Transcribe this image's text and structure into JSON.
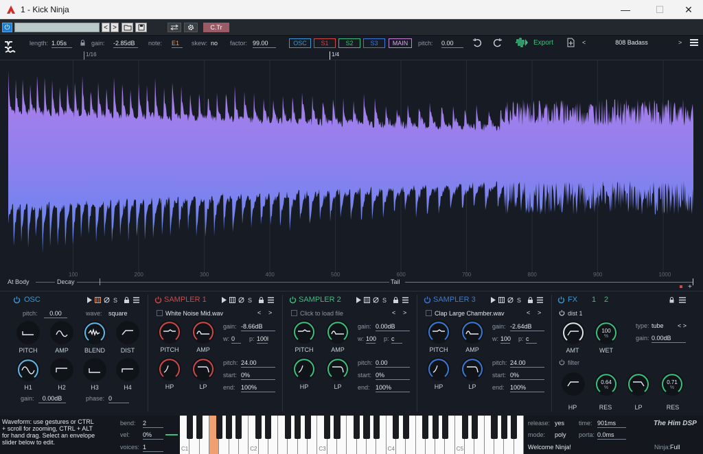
{
  "window": {
    "title": "1 - Kick Ninja",
    "min": "—",
    "max": "☐",
    "close": "✕"
  },
  "host": {
    "power": "⏻",
    "prev": "<",
    "next": ">",
    "ctr": "C.Tr"
  },
  "toolbar": {
    "length_label": "length:",
    "length_value": "1.05s",
    "gain_label": "gain:",
    "gain_value": "-2.85dB",
    "note_label": "note:",
    "note_value": "E1",
    "skew_label": "skew:",
    "skew_value": "no",
    "factor_label": "factor:",
    "factor_value": "99.00",
    "tabs": [
      "OSC",
      "S1",
      "S2",
      "S3",
      "MAIN"
    ],
    "pitch_label": "pitch:",
    "pitch_value": "0.00",
    "export_label": "Export",
    "preset_prev": "<",
    "preset_name": "808 Badass",
    "preset_next": ">"
  },
  "ruler": {
    "marks": [
      "1/16",
      "1/4"
    ]
  },
  "waveform": {
    "x_ticks": [
      "100",
      "200",
      "300",
      "400",
      "500",
      "600",
      "700",
      "800",
      "900",
      "1000"
    ],
    "env_labels": {
      "body": "At Body",
      "decay": "Decay",
      "tail": "Tail"
    }
  },
  "osc": {
    "title": "OSC",
    "pitch_label": "pitch:",
    "pitch_value": "0.00",
    "wave_label": "wave:",
    "wave_value": "square",
    "knobs": [
      "PITCH",
      "AMP",
      "BLEND",
      "DIST",
      "H1",
      "H2",
      "H3",
      "H4"
    ],
    "gain_label": "gain:",
    "gain_value": "0.00dB",
    "phase_label": "phase:",
    "phase_value": "0"
  },
  "sampler1": {
    "title": "SAMPLER 1",
    "file": "White Noise Mid.wav",
    "gain_label": "gain:",
    "gain_value": "-8.66dB",
    "w_label": "w:",
    "w_value": "0",
    "p_label": "p:",
    "p_value": "100l",
    "pitch_label": "pitch:",
    "pitch_value": "24.00",
    "start_label": "start:",
    "start_value": "0%",
    "end_label": "end:",
    "end_value": "100%",
    "knobs": [
      "PITCH",
      "AMP",
      "HP",
      "LP"
    ]
  },
  "sampler2": {
    "title": "SAMPLER 2",
    "file": "Click to load file",
    "gain_label": "gain:",
    "gain_value": "0.00dB",
    "w_label": "w:",
    "w_value": "100",
    "p_label": "p:",
    "p_value": "c",
    "pitch_label": "pitch:",
    "pitch_value": "0.00",
    "start_label": "start:",
    "start_value": "0%",
    "end_label": "end:",
    "end_value": "100%",
    "knobs": [
      "PITCH",
      "AMP",
      "HP",
      "LP"
    ]
  },
  "sampler3": {
    "title": "SAMPLER 3",
    "file": "Clap Large Chamber.wav",
    "gain_label": "gain:",
    "gain_value": "-2.64dB",
    "w_label": "w:",
    "w_value": "100",
    "p_label": "p:",
    "p_value": "c",
    "pitch_label": "pitch:",
    "pitch_value": "24.00",
    "start_label": "start:",
    "start_value": "0%",
    "end_label": "end:",
    "end_value": "100%",
    "knobs": [
      "PITCH",
      "AMP",
      "HP",
      "LP"
    ]
  },
  "fx": {
    "title": "FX",
    "tab1": "1",
    "tab2": "2",
    "dist_label": "dist 1",
    "amt_label": "AMT",
    "wet_label": "WET",
    "wet_value": "100",
    "wet_unit": "%",
    "type_label": "type:",
    "type_value": "tube",
    "type_arrows": "< >",
    "gain_label": "gain:",
    "gain_value": "0.00dB",
    "filter_label": "filter",
    "hp_label": "HP",
    "res1_label": "RES",
    "res1_value": "0.64",
    "res1_unit": "%",
    "lp_label": "LP",
    "res2_label": "RES",
    "res2_value": "0.71",
    "res2_unit": "%"
  },
  "bottom": {
    "info_line1": "Waveform: use gestures or CTRL",
    "info_line2": "+ scroll for zooming, CTRL + ALT",
    "info_line3": "for hand drag. Select an envelope",
    "info_line4": "slider below to edit.",
    "bend_label": "bend:",
    "bend_value": "2",
    "vel_label": "vel:",
    "vel_value": "0%",
    "voices_label": "voices:",
    "voices_value": "1",
    "octaves": [
      "C1",
      "C2",
      "C3",
      "C4",
      "C5"
    ],
    "release_label": "release:",
    "release_value": "yes",
    "time_label": "time:",
    "time_value": "901ms",
    "mode_label": "mode:",
    "mode_value": "poly",
    "porta_label": "porta:",
    "porta_value": "0.0ms",
    "welcome": "Welcome Ninja!",
    "ninja_label": "Ninja:",
    "ninja_value": "Full",
    "brand": "The Him DSP"
  }
}
